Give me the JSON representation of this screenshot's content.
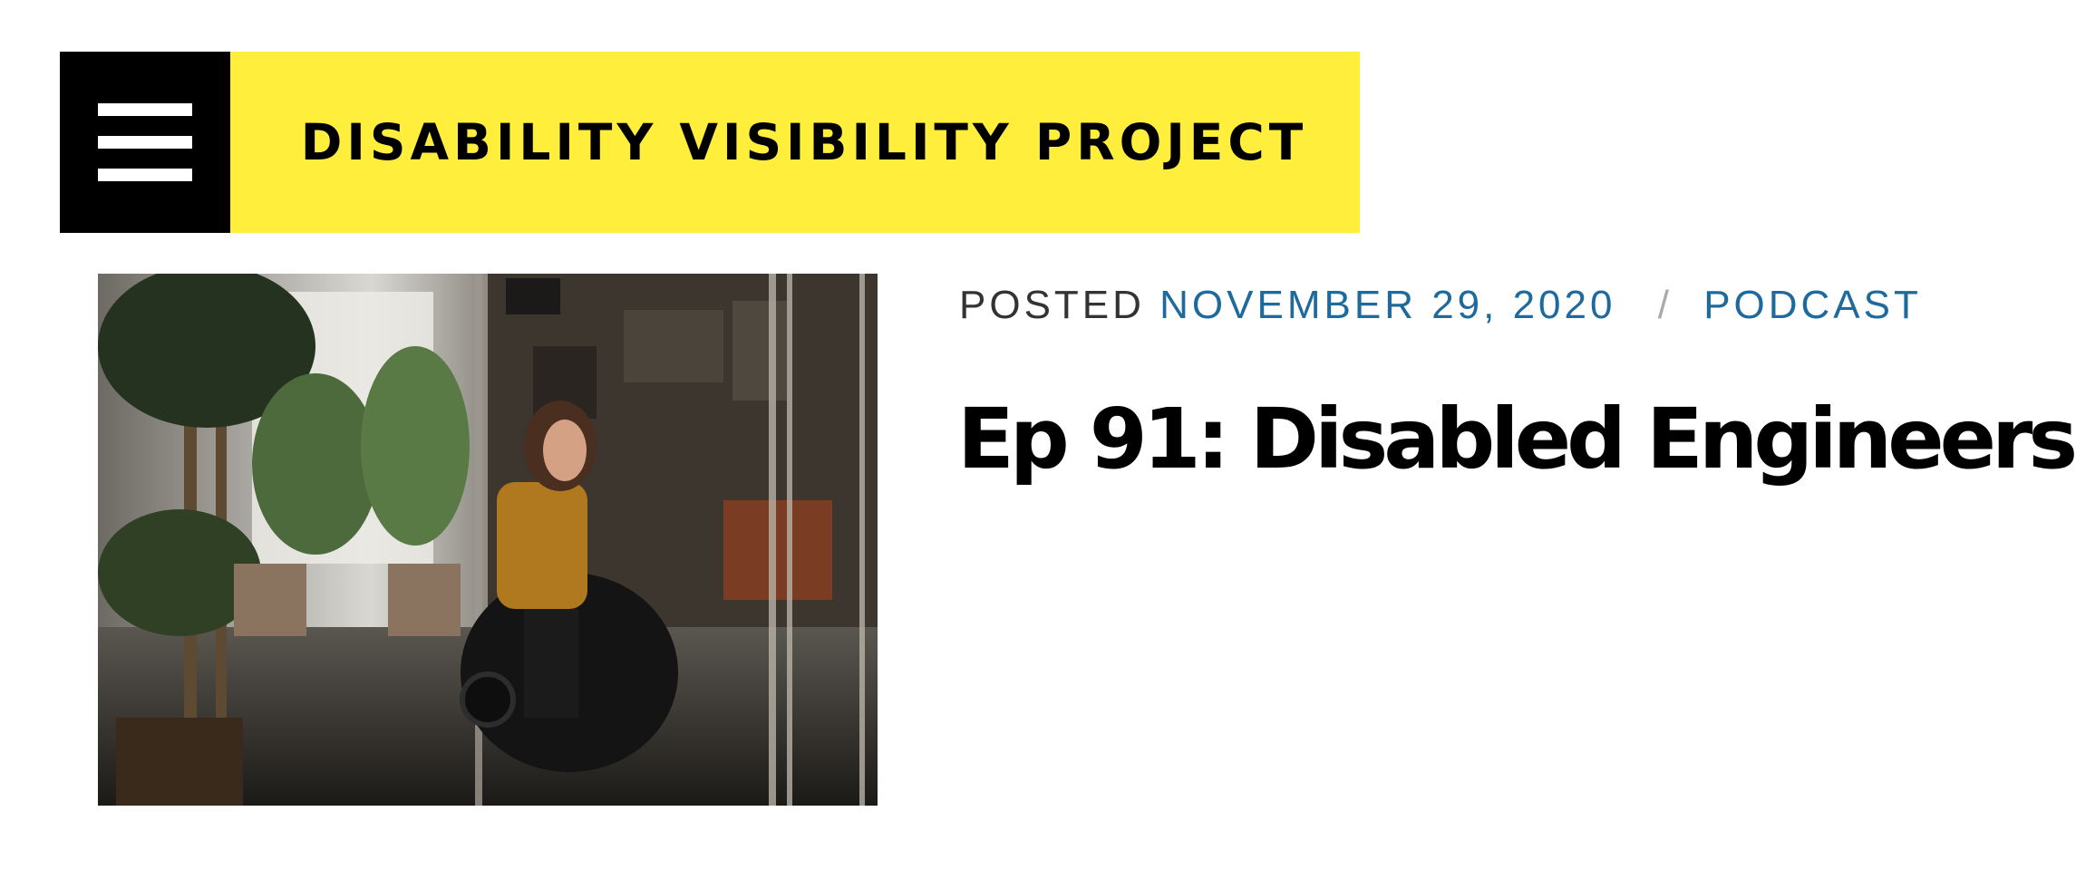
{
  "header": {
    "menu_icon": "hamburger-menu-icon",
    "site_title": "DISABILITY VISIBILITY PROJECT",
    "brand_color": "#ffee3b"
  },
  "article": {
    "meta_prefix": "POSTED",
    "date": "NOVEMBER 29, 2020",
    "separator": "/",
    "category": "PODCAST",
    "link_color": "#1e6a9c",
    "title": "Ep 91: Disabled Engineers",
    "thumbnail_subject": "photo-person-in-power-wheelchair-office"
  }
}
